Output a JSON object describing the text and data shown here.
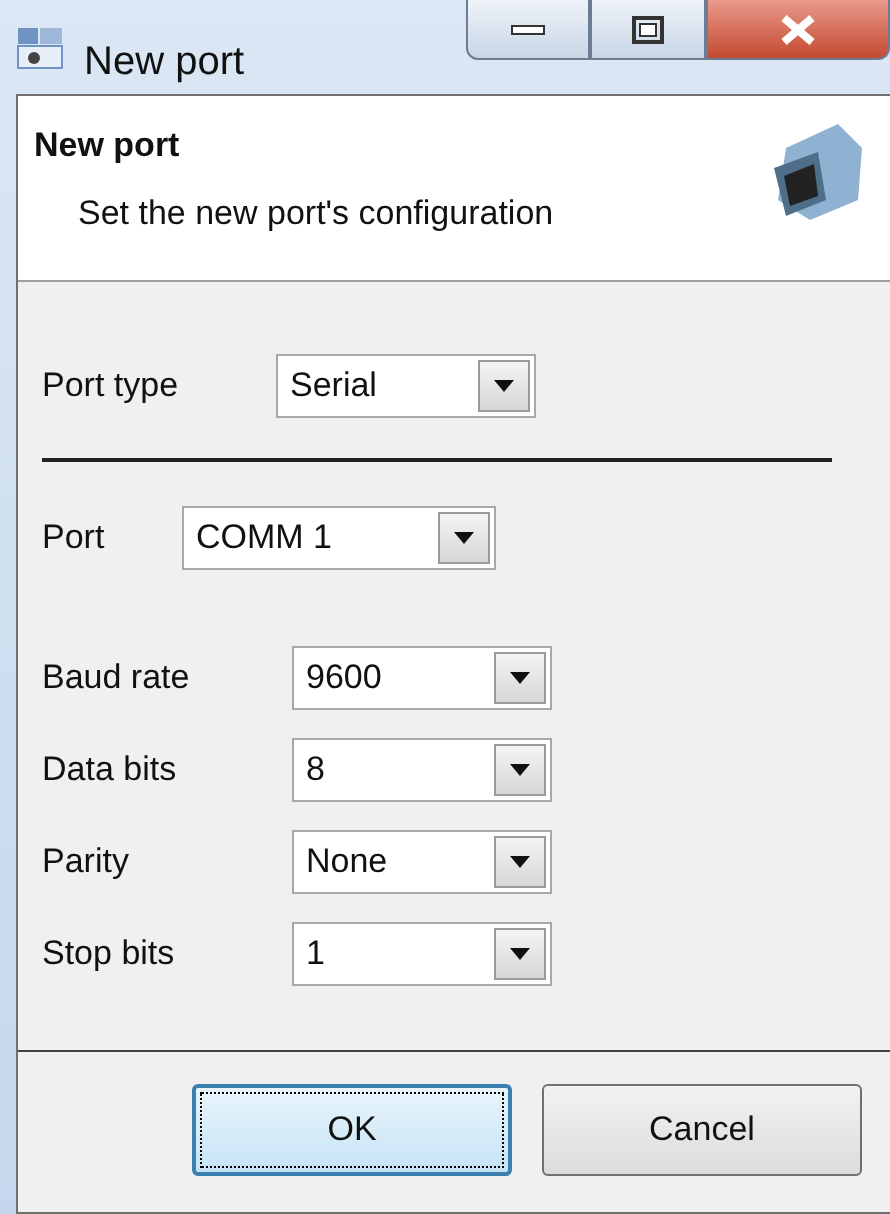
{
  "window": {
    "title": "New port"
  },
  "header": {
    "title": "New port",
    "subtitle": "Set the new port's configuration"
  },
  "port_type": {
    "label": "Port type",
    "value": "Serial"
  },
  "port": {
    "label": "Port",
    "value": "COMM 1"
  },
  "serial_settings": [
    {
      "label": "Baud rate",
      "value": "9600"
    },
    {
      "label": "Data bits",
      "value": "8"
    },
    {
      "label": "Parity",
      "value": "None"
    },
    {
      "label": "Stop bits",
      "value": "1"
    }
  ],
  "buttons": [
    {
      "label": "OK",
      "focused": true
    },
    {
      "label": "Cancel",
      "focused": false
    }
  ]
}
